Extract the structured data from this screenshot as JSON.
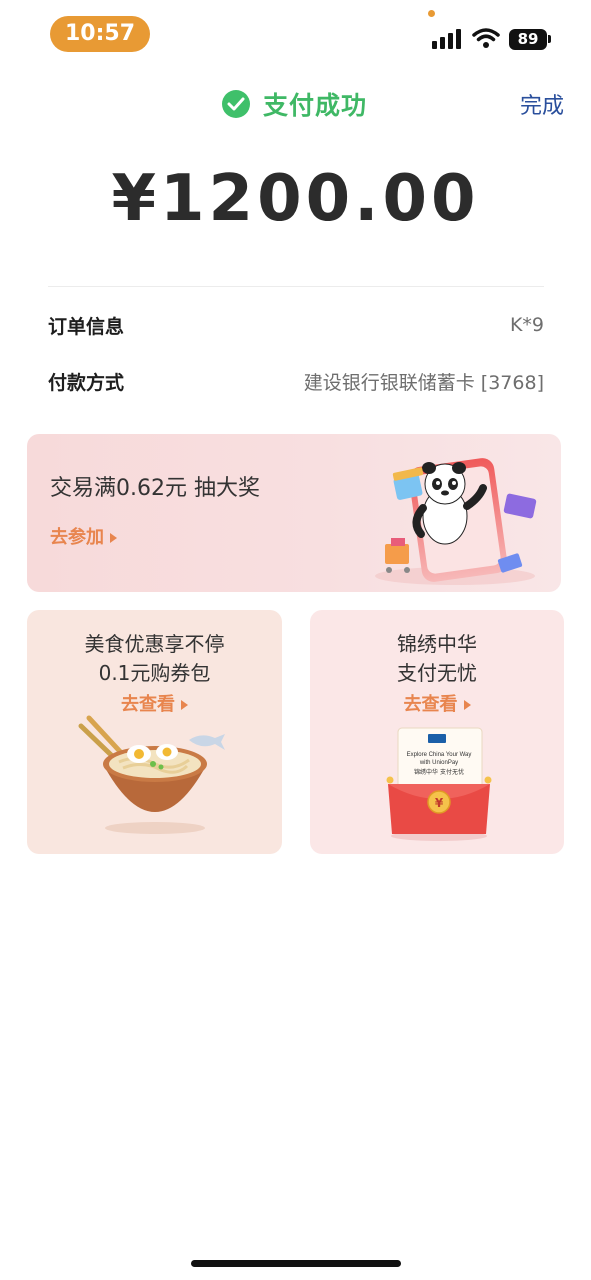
{
  "status_bar": {
    "time": "10:57",
    "battery": "89"
  },
  "header": {
    "success_text": "支付成功",
    "done_label": "完成"
  },
  "amount": "¥1200.00",
  "order_info": [
    {
      "label": "订单信息",
      "value": "K*9"
    },
    {
      "label": "付款方式",
      "value": "建设银行银联储蓄卡 [3768]"
    }
  ],
  "banner": {
    "title": "交易满0.62元 抽大奖",
    "link_label": "去参加"
  },
  "cards": [
    {
      "line1": "美食优惠享不停",
      "line2": "0.1元购券包",
      "link_label": "去查看"
    },
    {
      "line1": "锦绣中华",
      "line2": "支付无忧",
      "link_label": "去查看",
      "envelope_text_1": "Explore China Your Way",
      "envelope_text_2": "with UnionPay",
      "envelope_text_3": "锦绣中华  支付无忧",
      "envelope_coin": "¥"
    }
  ],
  "colors": {
    "accent_orange": "#e8854e",
    "success_green": "#3fb865",
    "link_blue": "#2a4f9c",
    "time_pill": "#e89a34"
  }
}
